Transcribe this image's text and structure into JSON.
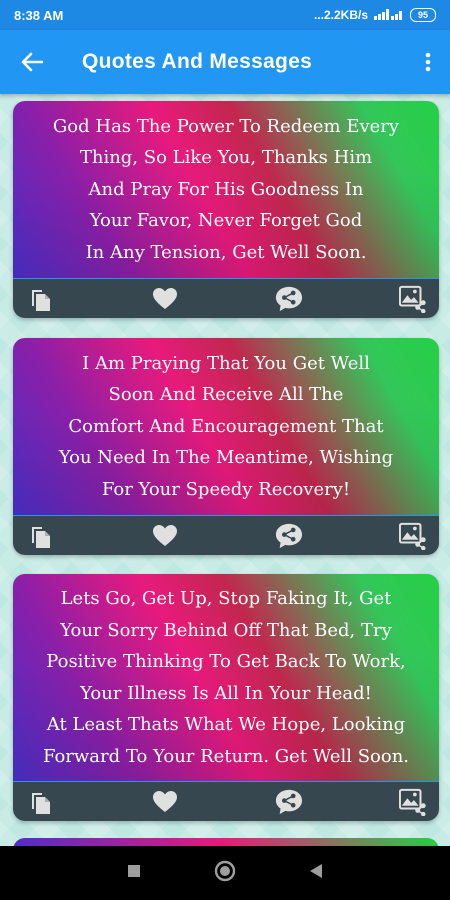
{
  "status_bar": {
    "time": "8:38 AM",
    "network_speed": "...2.2KB/s",
    "signal_label": "4G",
    "battery": "95"
  },
  "app_bar": {
    "title": "Quotes And Messages",
    "back_icon": "arrow-back-icon",
    "more_icon": "more-vertical-icon"
  },
  "cards": [
    {
      "text": "God Has The Power To Redeem Every\nThing, So Like You, Thanks Him\nAnd Pray For His Goodness In\nYour Favor, Never Forget God\nIn Any Tension, Get Well Soon."
    },
    {
      "text": "I Am Praying That You Get Well\nSoon And Receive All The\nComfort And Encouragement That\nYou Need In The Meantime, Wishing\nFor Your Speedy Recovery!"
    },
    {
      "text": "Lets Go, Get Up, Stop Faking It, Get\nYour Sorry Behind Off That Bed, Try\nPositive Thinking To Get Back To Work,\nYour Illness Is All In Your Head!\nAt Least Thats What We Hope, Looking\nForward To Your Return. Get Well Soon."
    }
  ],
  "card_actions": [
    "copy-icon",
    "heart-icon",
    "share-icon",
    "image-share-icon"
  ],
  "nav_bar": [
    "recents-square-icon",
    "home-circle-icon",
    "back-triangle-icon"
  ],
  "colors": {
    "app_bar": "#2196f3",
    "status_bar": "#1e88e5",
    "action_bar": "#37474f"
  }
}
